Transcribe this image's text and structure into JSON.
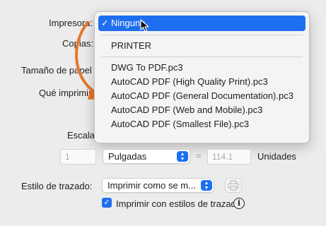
{
  "labels": {
    "printer": "Impresora:",
    "copies": "Copias:",
    "paper_size": "Tamaño de papel",
    "what_to_print": "Qué imprimir",
    "scale": "Escala",
    "units": "Unidades",
    "plot_style": "Estilo de trazado:"
  },
  "printer_menu": {
    "selected": "Ninguno",
    "check": "✓",
    "items": [
      "PRINTER",
      "DWG To PDF.pc3",
      "AutoCAD PDF (High Quality Print).pc3",
      "AutoCAD PDF (General Documentation).pc3",
      "AutoCAD PDF (Web and Mobile).pc3",
      "AutoCAD PDF (Smallest File).pc3"
    ]
  },
  "scale": {
    "left_value": "1",
    "units_select": "Pulgadas",
    "equals": "=",
    "right_value": "114.1"
  },
  "plot_style": {
    "select_value": "Imprimir como se m..."
  },
  "plot_with_styles": {
    "label": "Imprimir con estilos de trazado",
    "checked": true
  },
  "icons": {
    "checkmark": "✓",
    "stepper": "⌃⌄",
    "info": "i",
    "printer_icon": "printer-icon",
    "arrow": "orange-curved-arrow"
  },
  "colors": {
    "accent": "#1e6ff0",
    "arrow": "#e8762b",
    "background": "#ececec"
  }
}
